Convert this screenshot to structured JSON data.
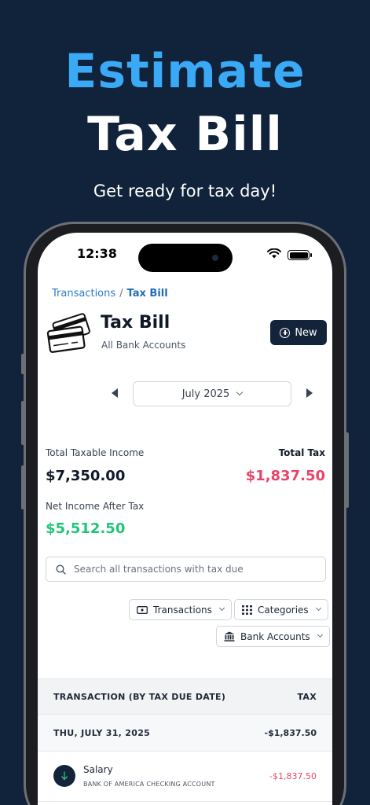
{
  "promo": {
    "headline_line1": "Estimate",
    "headline_line2": "Tax Bill",
    "tagline": "Get ready for tax day!"
  },
  "status_bar": {
    "time": "12:38"
  },
  "breadcrumb": {
    "parent": "Transactions",
    "separator": "/",
    "current": "Tax Bill"
  },
  "header": {
    "title": "Tax Bill",
    "subtitle": "All Bank Accounts",
    "new_button_label": "New"
  },
  "period": {
    "selected_month": "July 2025"
  },
  "summary": {
    "taxable_income_label": "Total Taxable Income",
    "taxable_income_value": "$7,350.00",
    "total_tax_label": "Total Tax",
    "total_tax_value": "$1,837.50",
    "net_income_label": "Net Income After Tax",
    "net_income_value": "$5,512.50"
  },
  "search": {
    "placeholder": "Search all transactions with tax due"
  },
  "filters": {
    "transactions": "Transactions",
    "categories": "Categories",
    "bank_accounts": "Bank Accounts"
  },
  "table": {
    "col_transaction": "TRANSACTION (BY TAX DUE DATE)",
    "col_tax": "TAX",
    "groups": [
      {
        "date": "THU, JULY 31, 2025",
        "total": "-$1,837.50",
        "rows": [
          {
            "name": "Salary",
            "account": "BANK OF AMERICA CHECKING ACCOUNT",
            "amount": "-$1,837.50"
          }
        ]
      }
    ]
  },
  "colors": {
    "background": "#11233a",
    "headline_accent": "#3aaaf6",
    "link": "#2b7bc4",
    "tax_red": "#e8456a",
    "income_green": "#22c47a",
    "primary_dark": "#13243a"
  }
}
